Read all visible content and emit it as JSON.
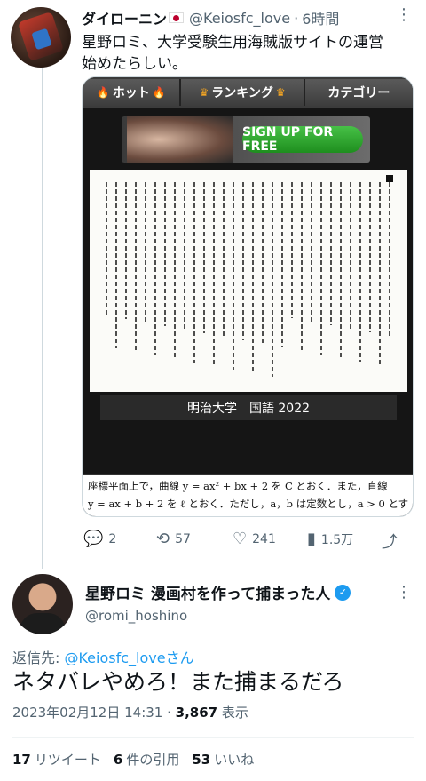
{
  "tweet1": {
    "display_name": "ダイローニン",
    "flag_icon": "japan-flag-icon",
    "handle": "@Keiosfc_love",
    "separator": "·",
    "time": "6時間",
    "text_line1": "星野ロミ、大学受験生用海賊版サイトの運営",
    "text_line2": "始めたらしい。",
    "media": {
      "tabs": [
        {
          "label": "ホット",
          "icon": "flame-icon"
        },
        {
          "label": "ランキング",
          "icon": "crown-icon"
        },
        {
          "label": "カテゴリー",
          "icon": ""
        }
      ],
      "banner_cta": "SIGN UP FOR FREE",
      "caption": "明治大学　国語 2022",
      "math_line1": "座標平面上で，曲線 y = ax² + bx + 2 を C とおく．また，直線",
      "math_line2": "y = ax + b + 2 を ℓ とおく．ただし，a，b は定数とし，a > 0 とす"
    },
    "actions": {
      "replies": "2",
      "retweets": "57",
      "likes": "241",
      "views": "1.5万"
    }
  },
  "tweet2": {
    "display_name": "星野ロミ 漫画村を作って捕まった人",
    "verified_icon": "verified-badge-icon",
    "handle": "@romi_hoshino",
    "reply_prefix": "返信先: ",
    "reply_to": "@Keiosfc_loveさん",
    "text": "ネタバレやめろ！また捕まるだろ",
    "timestamp": "2023年02月12日 14:31",
    "meta_separator": " · ",
    "views_count": "3,867",
    "views_label": " 表示",
    "retweets_count": "17",
    "retweets_label": "リツイート",
    "quotes_count": "6",
    "quotes_label": "件の引用",
    "likes_count": "53",
    "likes_label": "いいね"
  },
  "colors": {
    "text": "#0f1419",
    "secondary": "#536471",
    "link": "#1d9bf0",
    "divider": "#eff3f4"
  }
}
